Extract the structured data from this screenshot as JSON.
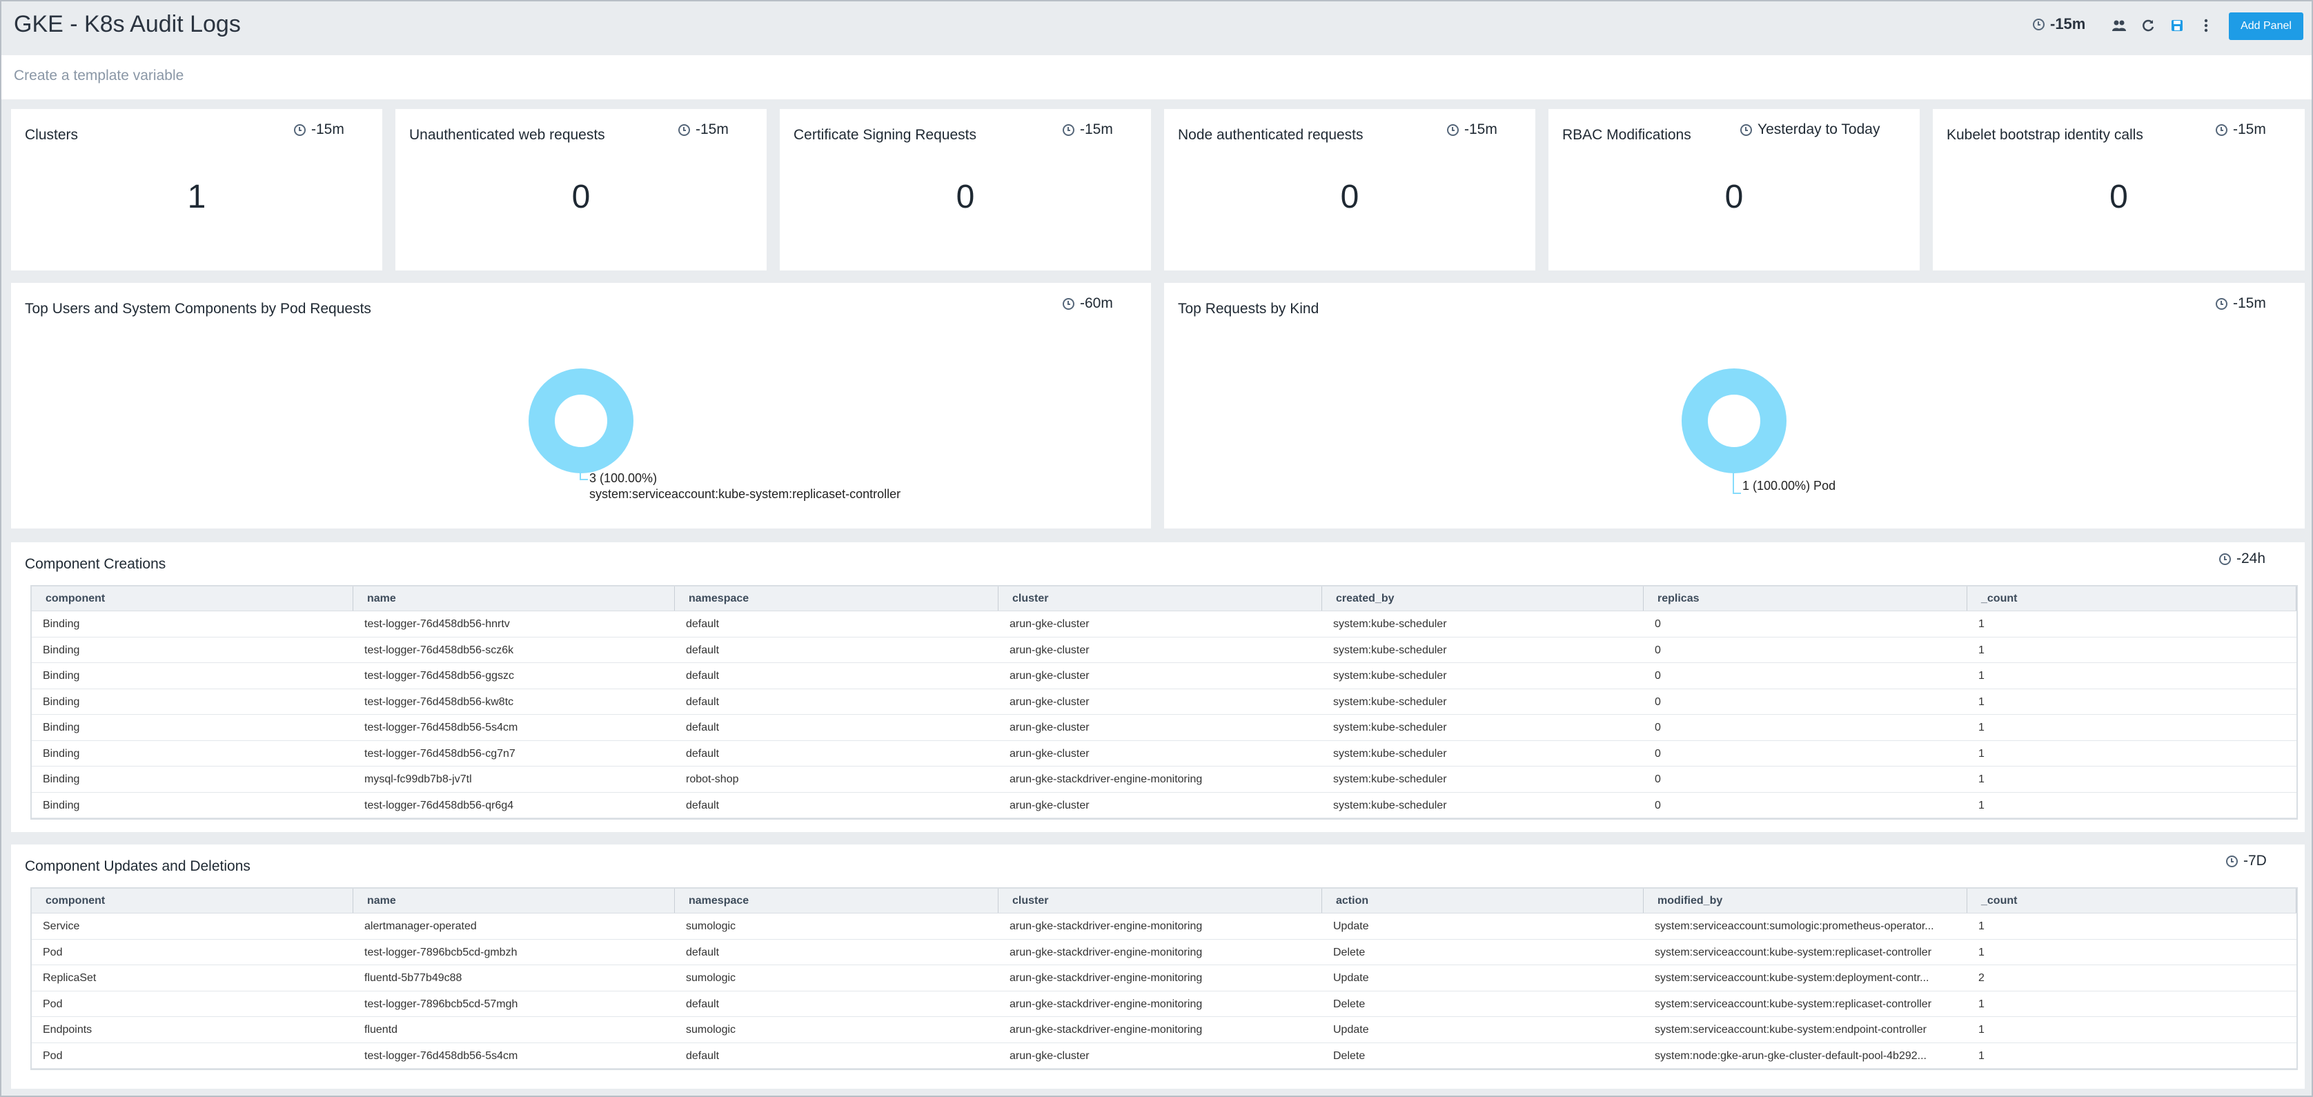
{
  "header": {
    "title": "GKE - K8s Audit Logs",
    "time_range": "-15m",
    "add_panel_label": "Add Panel",
    "icons": [
      "clock-icon",
      "share-icon",
      "refresh-icon",
      "save-icon",
      "more-options-icon"
    ]
  },
  "template_bar": {
    "link_text": "Create a template variable"
  },
  "stat_panels": [
    {
      "title": "Clusters",
      "time": "-15m",
      "value": "1"
    },
    {
      "title": "Unauthenticated web requests",
      "time": "-15m",
      "value": "0"
    },
    {
      "title": "Certificate Signing Requests",
      "time": "-15m",
      "value": "0"
    },
    {
      "title": "Node authenticated requests",
      "time": "-15m",
      "value": "0"
    },
    {
      "title": "RBAC Modifications",
      "time": "Yesterday to Today",
      "value": "0"
    },
    {
      "title": "Kubelet bootstrap identity calls",
      "time": "-15m",
      "value": "0"
    }
  ],
  "donut_panels": [
    {
      "title": "Top Users and System Components by Pod Requests",
      "time": "-60m",
      "slice_label": "3 (100.00%)",
      "slice_name": "system:serviceaccount:kube-system:replicaset-controller"
    },
    {
      "title": "Top Requests by Kind",
      "time": "-15m",
      "slice_label": "1 (100.00%) Pod"
    }
  ],
  "chart_data": [
    {
      "type": "pie",
      "title": "Top Users and System Components by Pod Requests",
      "categories": [
        "system:serviceaccount:kube-system:replicaset-controller"
      ],
      "values": [
        3
      ],
      "colors": [
        "#86dcfb"
      ]
    },
    {
      "type": "pie",
      "title": "Top Requests by Kind",
      "categories": [
        "Pod"
      ],
      "values": [
        1
      ],
      "colors": [
        "#86dcfb"
      ]
    }
  ],
  "creations": {
    "title": "Component Creations",
    "time": "-24h",
    "columns": [
      "component",
      "name",
      "namespace",
      "cluster",
      "created_by",
      "replicas",
      "_count"
    ],
    "rows": [
      [
        "Binding",
        "test-logger-76d458db56-hnrtv",
        "default",
        "arun-gke-cluster",
        "system:kube-scheduler",
        "0",
        "1"
      ],
      [
        "Binding",
        "test-logger-76d458db56-scz6k",
        "default",
        "arun-gke-cluster",
        "system:kube-scheduler",
        "0",
        "1"
      ],
      [
        "Binding",
        "test-logger-76d458db56-ggszc",
        "default",
        "arun-gke-cluster",
        "system:kube-scheduler",
        "0",
        "1"
      ],
      [
        "Binding",
        "test-logger-76d458db56-kw8tc",
        "default",
        "arun-gke-cluster",
        "system:kube-scheduler",
        "0",
        "1"
      ],
      [
        "Binding",
        "test-logger-76d458db56-5s4cm",
        "default",
        "arun-gke-cluster",
        "system:kube-scheduler",
        "0",
        "1"
      ],
      [
        "Binding",
        "test-logger-76d458db56-cg7n7",
        "default",
        "arun-gke-cluster",
        "system:kube-scheduler",
        "0",
        "1"
      ],
      [
        "Binding",
        "mysql-fc99db7b8-jv7tl",
        "robot-shop",
        "arun-gke-stackdriver-engine-monitoring",
        "system:kube-scheduler",
        "0",
        "1"
      ],
      [
        "Binding",
        "test-logger-76d458db56-qr6g4",
        "default",
        "arun-gke-cluster",
        "system:kube-scheduler",
        "0",
        "1"
      ]
    ]
  },
  "updates": {
    "title": "Component Updates and Deletions",
    "time": "-7D",
    "columns": [
      "component",
      "name",
      "namespace",
      "cluster",
      "action",
      "modified_by",
      "_count"
    ],
    "rows": [
      [
        "Service",
        "alertmanager-operated",
        "sumologic",
        "arun-gke-stackdriver-engine-monitoring",
        "Update",
        "system:serviceaccount:sumologic:prometheus-operator...",
        "1"
      ],
      [
        "Pod",
        "test-logger-7896bcb5cd-gmbzh",
        "default",
        "arun-gke-stackdriver-engine-monitoring",
        "Delete",
        "system:serviceaccount:kube-system:replicaset-controller",
        "1"
      ],
      [
        "ReplicaSet",
        "fluentd-5b77b49c88",
        "sumologic",
        "arun-gke-stackdriver-engine-monitoring",
        "Update",
        "system:serviceaccount:kube-system:deployment-contr...",
        "2"
      ],
      [
        "Pod",
        "test-logger-7896bcb5cd-57mgh",
        "default",
        "arun-gke-stackdriver-engine-monitoring",
        "Delete",
        "system:serviceaccount:kube-system:replicaset-controller",
        "1"
      ],
      [
        "Endpoints",
        "fluentd",
        "sumologic",
        "arun-gke-stackdriver-engine-monitoring",
        "Update",
        "system:serviceaccount:kube-system:endpoint-controller",
        "1"
      ],
      [
        "Pod",
        "test-logger-76d458db56-5s4cm",
        "default",
        "arun-gke-cluster",
        "Delete",
        "system:node:gke-arun-gke-cluster-default-pool-4b292...",
        "1"
      ]
    ]
  }
}
